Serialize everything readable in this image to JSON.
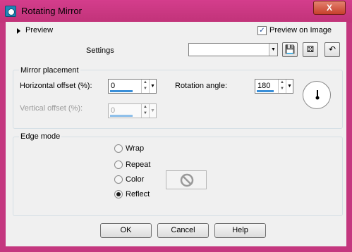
{
  "window": {
    "title": "Rotating Mirror",
    "close_label": "X"
  },
  "top": {
    "preview_label": "Preview",
    "preview_on_image_label": "Preview on Image",
    "preview_on_image_checked": true,
    "settings_label": "Settings",
    "settings_value": ""
  },
  "mirror_placement": {
    "group_label": "Mirror placement",
    "horizontal_offset_label": "Horizontal offset (%):",
    "horizontal_offset_value": "0",
    "vertical_offset_label": "Vertical offset (%):",
    "vertical_offset_value": "0",
    "rotation_angle_label": "Rotation angle:",
    "rotation_angle_value": "180"
  },
  "edge_mode": {
    "group_label": "Edge mode",
    "options": [
      {
        "label": "Wrap",
        "checked": false
      },
      {
        "label": "Repeat",
        "checked": false
      },
      {
        "label": "Color",
        "checked": false
      },
      {
        "label": "Reflect",
        "checked": true
      }
    ]
  },
  "buttons": {
    "ok": "OK",
    "cancel": "Cancel",
    "help": "Help"
  }
}
